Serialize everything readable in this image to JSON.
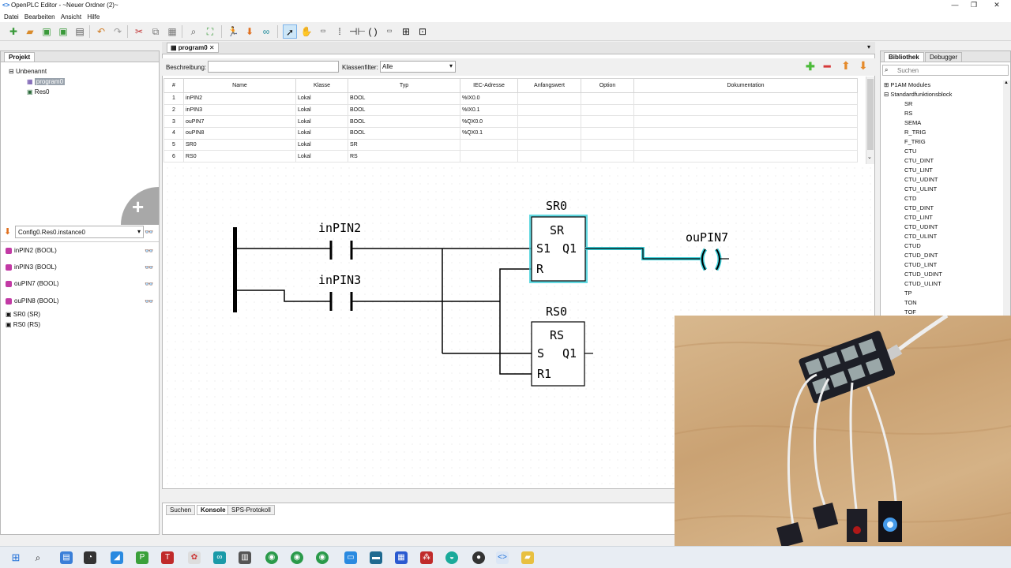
{
  "window": {
    "title": "OpenPLC Editor - ~Neuer Ordner (2)~"
  },
  "menu": [
    "Datei",
    "Bearbeiten",
    "Ansicht",
    "Hilfe"
  ],
  "project_panel": {
    "tab": "Projekt",
    "tree": {
      "root": "Unbenannt",
      "program": "program0",
      "resource": "Res0"
    },
    "instance_select": "Config0.Res0.instance0",
    "variables": [
      "inPIN2 (BOOL)",
      "inPIN3 (BOOL)",
      "ouPIN7 (BOOL)",
      "ouPIN8 (BOOL)"
    ],
    "blocks": [
      "SR0 (SR)",
      "RS0 (RS)"
    ]
  },
  "editor": {
    "tab": "program0",
    "description_label": "Beschreibung:",
    "description_value": "",
    "class_filter_label": "Klassenfilter:",
    "class_filter_value": "Alle",
    "columns": [
      "#",
      "Name",
      "Klasse",
      "Typ",
      "IEC-Adresse",
      "Anfangswert",
      "Option",
      "Dokumentation"
    ],
    "rows": [
      [
        "1",
        "inPIN2",
        "Lokal",
        "BOOL",
        "%IX0.0",
        "",
        "",
        ""
      ],
      [
        "2",
        "inPIN3",
        "Lokal",
        "BOOL",
        "%IX0.1",
        "",
        "",
        ""
      ],
      [
        "3",
        "ouPIN7",
        "Lokal",
        "BOOL",
        "%QX0.0",
        "",
        "",
        ""
      ],
      [
        "4",
        "ouPIN8",
        "Lokal",
        "BOOL",
        "%QX0.1",
        "",
        "",
        ""
      ],
      [
        "5",
        "SR0",
        "Lokal",
        "SR",
        "",
        "",
        "",
        ""
      ],
      [
        "6",
        "RS0",
        "Lokal",
        "RS",
        "",
        "",
        "",
        ""
      ]
    ]
  },
  "ladder": {
    "contact1": "inPIN2",
    "contact2": "inPIN3",
    "coil": "ouPIN7",
    "sr_instance": "SR0",
    "sr_type": "SR",
    "sr_in1": "S1",
    "sr_in2": "R",
    "sr_out": "Q1",
    "rs_instance": "RS0",
    "rs_type": "RS",
    "rs_in1": "S",
    "rs_in2": "R1",
    "rs_out": "Q1",
    "active_color": "#3ccfd9"
  },
  "bottom_tabs": [
    "Suchen",
    "Konsole",
    "SPS-Protokoll"
  ],
  "library_panel": {
    "tabs": [
      "Bibliothek",
      "Debugger"
    ],
    "search_placeholder": "Suchen",
    "groups": [
      "P1AM Modules",
      "Standardfunktionsblock"
    ],
    "items": [
      "SR",
      "RS",
      "SEMA",
      "R_TRIG",
      "F_TRIG",
      "CTU",
      "CTU_DINT",
      "CTU_LINT",
      "CTU_UDINT",
      "CTU_ULINT",
      "CTD",
      "CTD_DINT",
      "CTD_LINT",
      "CTD_UDINT",
      "CTD_ULINT",
      "CTUD",
      "CTUD_DINT",
      "CTUD_LINT",
      "CTUD_UDINT",
      "CTUD_ULINT",
      "TP",
      "TON",
      "TOF"
    ]
  }
}
